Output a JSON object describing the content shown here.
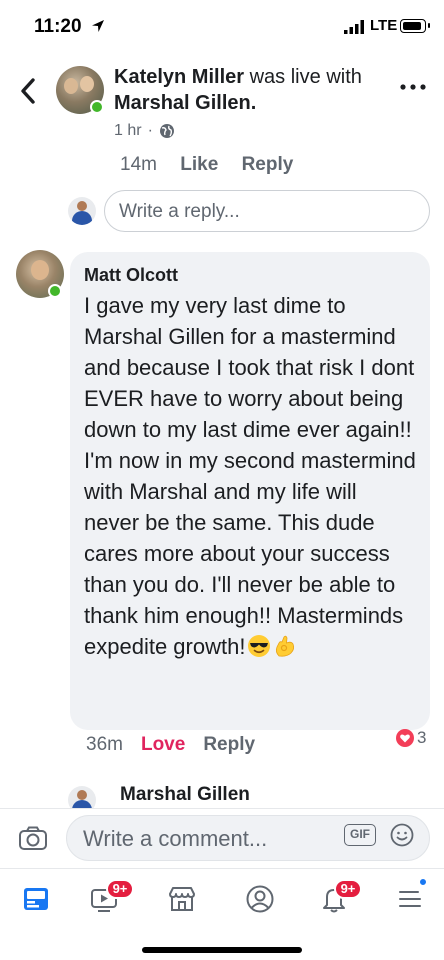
{
  "status_bar": {
    "time": "11:20",
    "network": "LTE"
  },
  "header": {
    "title_name": "Katelyn Miller",
    "title_middle": "was live",
    "title_with": "with",
    "title_partner": "Marshal Gillen.",
    "meta_time": "1 hr",
    "meta_separator": "·"
  },
  "previous_comment": {
    "time": "14m",
    "like_label": "Like",
    "reply_label": "Reply"
  },
  "reply_box": {
    "placeholder": "Write a reply..."
  },
  "comment": {
    "author": "Matt Olcott",
    "text": "I gave my very last dime to Marshal Gillen  for a mastermind and because I took that risk I dont EVER have to worry about being down to my last dime ever again!! I'm now in my second mastermind with Marshal and my life will never be the same. This dude cares more about your success than you do. I'll never be able to thank him enough!! Masterminds expedite growth!",
    "emojis": [
      "smiling-face-with-sunglasses",
      "ok-hand"
    ],
    "time": "36m",
    "reaction_label": "Love",
    "reply_label": "Reply",
    "reaction_count": "3",
    "reaction_icon": "heart"
  },
  "sub_reply": {
    "author": "Marshal Gillen"
  },
  "composer": {
    "placeholder": "Write a comment...",
    "gif_label": "GIF"
  },
  "tab_bar": {
    "tabs": [
      {
        "name": "news-feed",
        "icon": "newsfeed-icon"
      },
      {
        "name": "watch",
        "icon": "video-icon",
        "badge": "9+"
      },
      {
        "name": "marketplace",
        "icon": "shop-icon"
      },
      {
        "name": "profile",
        "icon": "profile-icon"
      },
      {
        "name": "notifications",
        "icon": "bell-icon",
        "badge": "9+"
      },
      {
        "name": "menu",
        "icon": "hamburger-icon"
      }
    ]
  },
  "colors": {
    "accent": "#1877f2",
    "love": "#e0245e",
    "online": "#42b72a",
    "badge": "#e41e3f"
  }
}
